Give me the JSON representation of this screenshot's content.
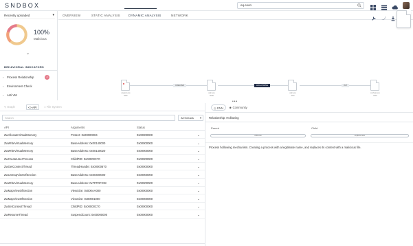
{
  "app": {
    "logo": "SNDBOX"
  },
  "search": {
    "value": "eq.exon"
  },
  "left": {
    "dropdown": "Recently uploaded",
    "score": "100%",
    "score_label": "Malicious",
    "indicators_heading": "BEHAVIORAL INDICATORS",
    "indicators": [
      {
        "label": "Process Relationship",
        "badge": "2"
      },
      {
        "label": "Environment Check"
      },
      {
        "label": "Anti VM"
      }
    ]
  },
  "tabs": [
    "OVERVIEW",
    "STATIC ANALYSIS",
    "DYNAMIC ANALYSIS",
    "NETWORK"
  ],
  "graph": {
    "nodes": [
      {
        "name": "unpack.exe",
        "sub": "6d4c"
      },
      {
        "name": "calc.exe",
        "sub": "6e8a"
      },
      {
        "name": "calc.exe",
        "sub": "4f12"
      },
      {
        "name": "svchost.exe",
        "sub": "2a10"
      }
    ],
    "edges": [
      "CREATED",
      "HOLLOWING",
      "INIT"
    ]
  },
  "subtabs": [
    "Graph",
    "API",
    "File System"
  ],
  "filter": {
    "placeholder": "Search",
    "threads": "All threads"
  },
  "table": {
    "headers": [
      "API",
      "Arguments",
      "Status"
    ],
    "rows": [
      [
        "ZwAllocateVirtualMemory",
        "Protect: 0x00000004",
        "0x00000000"
      ],
      [
        "ZwWriteVirtualMemory",
        "BaseAddress: 0x00140000",
        "0x00000000"
      ],
      [
        "ZwWriteVirtualMemory",
        "BaseAddress: 0x00140020",
        "0x00000000"
      ],
      [
        "ZwCreateUserProcess",
        "ChildPID: 0x00000C70",
        "0x00000000"
      ],
      [
        "ZwGetContextThread",
        "ThreadHandle: 0x00000670",
        "0x00000000"
      ],
      [
        "ZwUnmapViewOfSection",
        "BaseAddress: 0x00400000",
        "0x00000000"
      ],
      [
        "ZwWriteVirtualMemory",
        "BaseAddress: 0x7FFDF238",
        "0x00000000"
      ],
      [
        "ZwMapViewOfSection",
        "ViewSize: 0x000AA000",
        "0x00000000"
      ],
      [
        "ZwMapViewOfSection",
        "ViewSize: 0x00001000",
        "0x00000000"
      ],
      [
        "ZwSetContextThread",
        "ChildPID: 0x00000C70",
        "0x00000000"
      ],
      [
        "ZwResumeThread",
        "SuspendCount: 0x00000000",
        "0x00000000"
      ]
    ]
  },
  "right": {
    "tabs": [
      "DNN",
      "Community"
    ],
    "relationship": "Relationship: Hollowing",
    "parent_label": "Parent",
    "child_label": "Child",
    "parent_pill": "calc.exe",
    "child_pill": "explorer.exe",
    "description": "Process hollowing mechanism. Creating a process with a legitimate name, and replaces its content with a malicious file."
  }
}
